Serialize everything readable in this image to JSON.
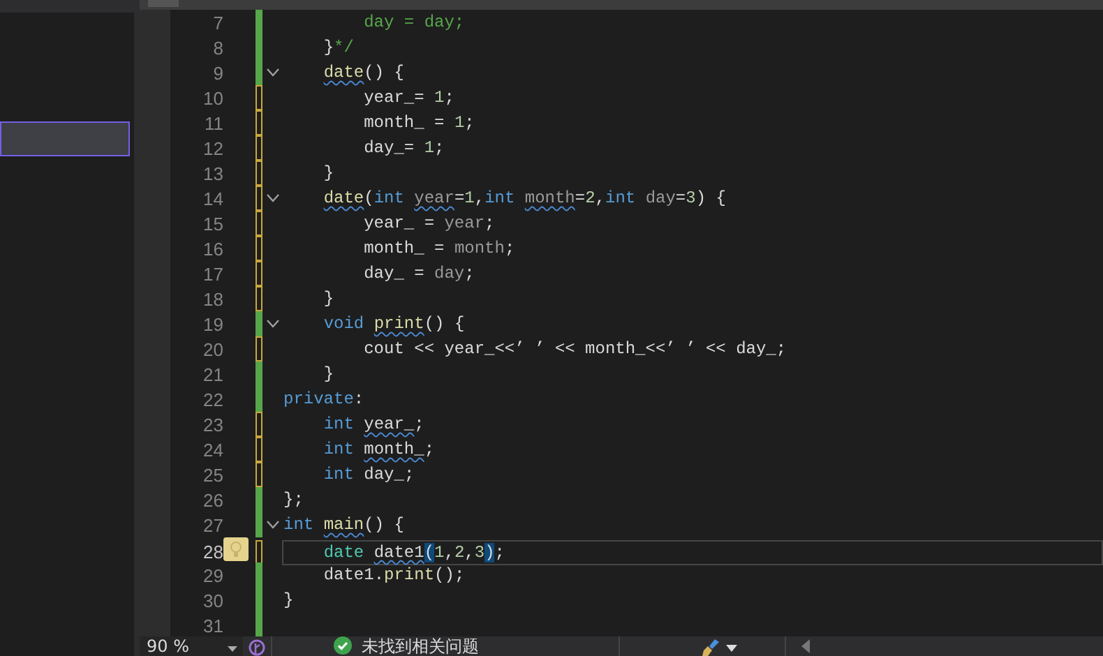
{
  "side_panel": {
    "rows": [
      {
        "selected": true
      }
    ]
  },
  "editor": {
    "lines": [
      {
        "number": "7",
        "unsaved": false,
        "foldable": false,
        "current": false,
        "tokens": [
          {
            "text": "        day = day;",
            "kind": "comment"
          }
        ]
      },
      {
        "number": "8",
        "unsaved": false,
        "foldable": false,
        "current": false,
        "tokens": [
          {
            "text": "    }",
            "kind": "plain"
          },
          {
            "text": "*/",
            "kind": "comment"
          }
        ]
      },
      {
        "number": "9",
        "unsaved": false,
        "foldable": true,
        "current": false,
        "tokens": [
          {
            "text": "    date",
            "kind": "fn",
            "squiggle": true
          },
          {
            "text": "() {",
            "kind": "plain"
          }
        ]
      },
      {
        "number": "10",
        "unsaved": true,
        "foldable": false,
        "current": false,
        "tokens": [
          {
            "text": "        year_",
            "kind": "var"
          },
          {
            "text": "= ",
            "kind": "plain"
          },
          {
            "text": "1",
            "kind": "num"
          },
          {
            "text": ";",
            "kind": "plain"
          }
        ]
      },
      {
        "number": "11",
        "unsaved": true,
        "foldable": false,
        "current": false,
        "tokens": [
          {
            "text": "        month_",
            "kind": "var"
          },
          {
            "text": " = ",
            "kind": "plain"
          },
          {
            "text": "1",
            "kind": "num"
          },
          {
            "text": ";",
            "kind": "plain"
          }
        ]
      },
      {
        "number": "12",
        "unsaved": true,
        "foldable": false,
        "current": false,
        "tokens": [
          {
            "text": "        day_",
            "kind": "var"
          },
          {
            "text": "= ",
            "kind": "plain"
          },
          {
            "text": "1",
            "kind": "num"
          },
          {
            "text": ";",
            "kind": "plain"
          }
        ]
      },
      {
        "number": "13",
        "unsaved": true,
        "foldable": false,
        "current": false,
        "tokens": [
          {
            "text": "    }",
            "kind": "plain"
          }
        ]
      },
      {
        "number": "14",
        "unsaved": true,
        "foldable": true,
        "current": false,
        "tokens": [
          {
            "text": "    date",
            "kind": "fn",
            "squiggle": true
          },
          {
            "text": "(",
            "kind": "plain"
          },
          {
            "text": "int",
            "kind": "kw"
          },
          {
            "text": " year",
            "kind": "param",
            "squiggle": true
          },
          {
            "text": "=",
            "kind": "plain"
          },
          {
            "text": "1",
            "kind": "num"
          },
          {
            "text": ",",
            "kind": "plain"
          },
          {
            "text": "int",
            "kind": "kw"
          },
          {
            "text": " month",
            "kind": "param",
            "squiggle": true
          },
          {
            "text": "=",
            "kind": "plain"
          },
          {
            "text": "2",
            "kind": "num"
          },
          {
            "text": ",",
            "kind": "plain"
          },
          {
            "text": "int",
            "kind": "kw"
          },
          {
            "text": " day",
            "kind": "param"
          },
          {
            "text": "=",
            "kind": "plain"
          },
          {
            "text": "3",
            "kind": "num"
          },
          {
            "text": ") {",
            "kind": "plain"
          }
        ]
      },
      {
        "number": "15",
        "unsaved": true,
        "foldable": false,
        "current": false,
        "tokens": [
          {
            "text": "        year_",
            "kind": "var"
          },
          {
            "text": " = ",
            "kind": "plain"
          },
          {
            "text": "year",
            "kind": "param"
          },
          {
            "text": ";",
            "kind": "plain"
          }
        ]
      },
      {
        "number": "16",
        "unsaved": true,
        "foldable": false,
        "current": false,
        "tokens": [
          {
            "text": "        month_",
            "kind": "var"
          },
          {
            "text": " = ",
            "kind": "plain"
          },
          {
            "text": "month",
            "kind": "param"
          },
          {
            "text": ";",
            "kind": "plain"
          }
        ]
      },
      {
        "number": "17",
        "unsaved": true,
        "foldable": false,
        "current": false,
        "tokens": [
          {
            "text": "        day_",
            "kind": "var"
          },
          {
            "text": " = ",
            "kind": "plain"
          },
          {
            "text": "day",
            "kind": "param"
          },
          {
            "text": ";",
            "kind": "plain"
          }
        ]
      },
      {
        "number": "18",
        "unsaved": true,
        "foldable": false,
        "current": false,
        "tokens": [
          {
            "text": "    }",
            "kind": "plain"
          }
        ]
      },
      {
        "number": "19",
        "unsaved": false,
        "foldable": true,
        "current": false,
        "tokens": [
          {
            "text": "    void",
            "kind": "kw"
          },
          {
            "text": " print",
            "kind": "fn",
            "squiggle": true
          },
          {
            "text": "() {",
            "kind": "plain"
          }
        ]
      },
      {
        "number": "20",
        "unsaved": true,
        "foldable": false,
        "current": false,
        "tokens": [
          {
            "text": "        cout << ",
            "kind": "plain"
          },
          {
            "text": "year_",
            "kind": "var"
          },
          {
            "text": "<<’ ’ << ",
            "kind": "plain"
          },
          {
            "text": "month_",
            "kind": "var"
          },
          {
            "text": "<<’ ’ << ",
            "kind": "plain"
          },
          {
            "text": "day_",
            "kind": "var"
          },
          {
            "text": ";",
            "kind": "plain"
          }
        ]
      },
      {
        "number": "21",
        "unsaved": false,
        "foldable": false,
        "current": false,
        "tokens": [
          {
            "text": "    }",
            "kind": "plain"
          }
        ]
      },
      {
        "number": "22",
        "unsaved": false,
        "foldable": false,
        "current": false,
        "tokens": [
          {
            "text": "private",
            "kind": "kw"
          },
          {
            "text": ":",
            "kind": "plain"
          }
        ]
      },
      {
        "number": "23",
        "unsaved": true,
        "foldable": false,
        "current": false,
        "tokens": [
          {
            "text": "    int",
            "kind": "kw"
          },
          {
            "text": " year_",
            "kind": "var",
            "squiggle": true
          },
          {
            "text": ";",
            "kind": "plain"
          }
        ]
      },
      {
        "number": "24",
        "unsaved": true,
        "foldable": false,
        "current": false,
        "tokens": [
          {
            "text": "    int",
            "kind": "kw"
          },
          {
            "text": " month_",
            "kind": "var",
            "squiggle": true
          },
          {
            "text": ";",
            "kind": "plain"
          }
        ]
      },
      {
        "number": "25",
        "unsaved": true,
        "foldable": false,
        "current": false,
        "tokens": [
          {
            "text": "    int",
            "kind": "kw"
          },
          {
            "text": " day_",
            "kind": "var"
          },
          {
            "text": ";",
            "kind": "plain"
          }
        ]
      },
      {
        "number": "26",
        "unsaved": false,
        "foldable": false,
        "current": false,
        "tokens": [
          {
            "text": "};",
            "kind": "plain"
          }
        ]
      },
      {
        "number": "27",
        "unsaved": false,
        "foldable": true,
        "current": false,
        "tokens": [
          {
            "text": "int",
            "kind": "kw"
          },
          {
            "text": " main",
            "kind": "fn",
            "squiggle": true
          },
          {
            "text": "() {",
            "kind": "plain"
          }
        ]
      },
      {
        "number": "28",
        "unsaved": true,
        "foldable": false,
        "current": true,
        "tokens": [
          {
            "text": "    date",
            "kind": "type"
          },
          {
            "text": " date1",
            "kind": "var",
            "squiggle": true
          },
          {
            "text": "(",
            "kind": "plain",
            "match": true
          },
          {
            "text": "1",
            "kind": "num"
          },
          {
            "text": ",",
            "kind": "plain"
          },
          {
            "text": "2",
            "kind": "num"
          },
          {
            "text": ",",
            "kind": "plain"
          },
          {
            "text": "3",
            "kind": "num"
          },
          {
            "text": ")",
            "kind": "plain",
            "match": true
          },
          {
            "text": ";",
            "kind": "plain"
          }
        ]
      },
      {
        "number": "29",
        "unsaved": false,
        "foldable": false,
        "current": false,
        "tokens": [
          {
            "text": "    date1.",
            "kind": "var"
          },
          {
            "text": "print",
            "kind": "fn"
          },
          {
            "text": "();",
            "kind": "plain"
          }
        ]
      },
      {
        "number": "30",
        "unsaved": false,
        "foldable": false,
        "current": false,
        "tokens": [
          {
            "text": "}",
            "kind": "plain"
          }
        ]
      },
      {
        "number": "31",
        "unsaved": false,
        "foldable": false,
        "current": false
      }
    ]
  },
  "status_bar": {
    "zoom": "90 %",
    "issues": "未找到相关问题"
  }
}
